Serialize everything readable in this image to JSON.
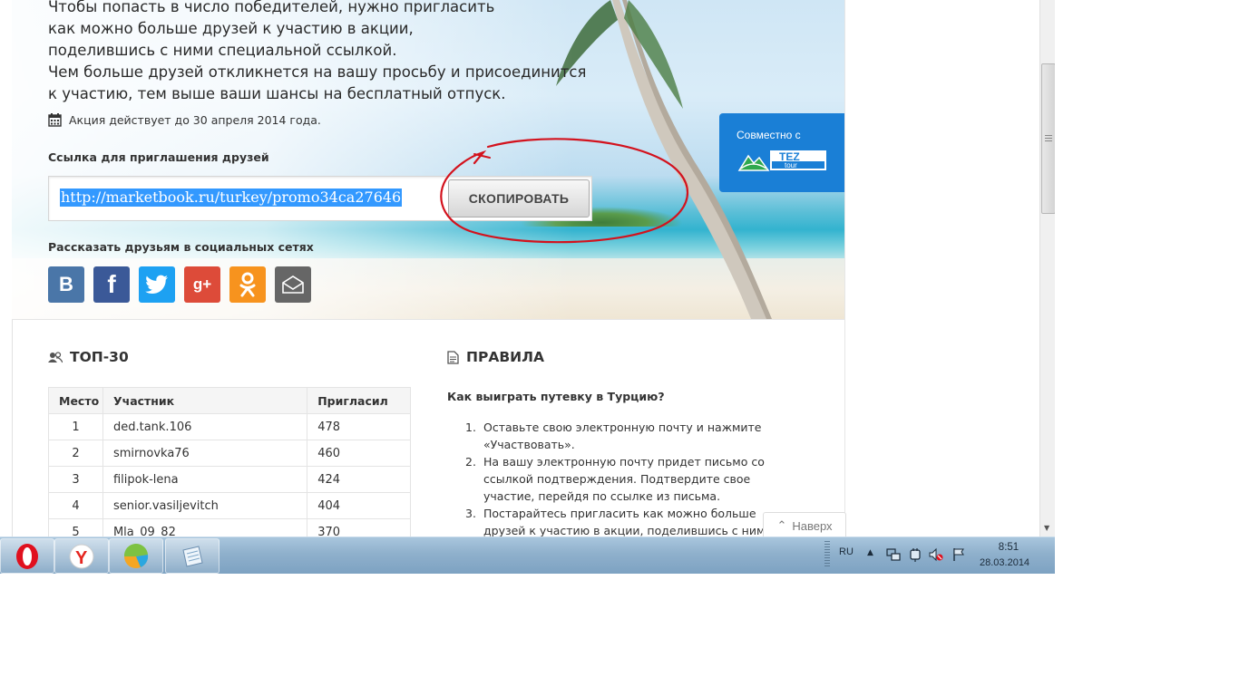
{
  "promo": {
    "lines": [
      "Чтобы попасть в число победителей, нужно пригласить",
      "как можно больше друзей к участию в акции,",
      "поделившись с ними специальной ссылкой.",
      "Чем больше друзей откликнется на вашу просьбу и присоединится",
      "к участию, тем выше ваши шансы на бесплатный отпуск."
    ],
    "date_text": "Акция действует до 30 апреля 2014 года.",
    "invite_label": "Ссылка для приглашения друзей",
    "invite_url": "http://marketbook.ru/turkey/promo34ca27646",
    "copy_button": "СКОПИРОВАТЬ",
    "share_label": "Рассказать друзьям в социальных сетях",
    "social": [
      {
        "name": "vk-icon",
        "glyph": "В",
        "color": "#4a76a8"
      },
      {
        "name": "facebook-icon",
        "glyph": "f",
        "color": "#3b5998"
      },
      {
        "name": "twitter-icon",
        "glyph": "",
        "color": "#1da1f2"
      },
      {
        "name": "google-plus-icon",
        "glyph": "g+",
        "color": "#dd4b39"
      },
      {
        "name": "odnoklassniki-icon",
        "glyph": "",
        "color": "#f7931e"
      },
      {
        "name": "mail-icon",
        "glyph": "",
        "color": "#666666"
      }
    ],
    "partner": {
      "label": "Совместно с",
      "logo_text_top": "TEZ",
      "logo_text_bottom": "tour"
    }
  },
  "top30": {
    "title": "ТОП-30",
    "columns": [
      "Место",
      "Участник",
      "Пригласил"
    ],
    "rows": [
      {
        "place": "1",
        "user": "ded.tank.106",
        "invited": "478"
      },
      {
        "place": "2",
        "user": "smirnovka76",
        "invited": "460"
      },
      {
        "place": "3",
        "user": "filipok-lena",
        "invited": "424"
      },
      {
        "place": "4",
        "user": "senior.vasiljevitch",
        "invited": "404"
      },
      {
        "place": "5",
        "user": "Mla_09_82",
        "invited": "370"
      }
    ]
  },
  "rules": {
    "title": "ПРАВИЛА",
    "question": "Как выиграть путевку в Турцию?",
    "items": [
      {
        "num": "1.",
        "text": "Оставьте свою электронную почту и нажмите «Участвовать»."
      },
      {
        "num": "2.",
        "text": "На вашу электронную почту придет письмо со ссылкой подтверждения. Подтвердите свое участие, перейдя по ссылке из письма."
      },
      {
        "num": "3.",
        "text": "Постарайтесь пригласить как можно больше друзей к участию в акции, поделившись с ними специальной"
      }
    ]
  },
  "back_to_top": "Наверх",
  "taskbar": {
    "apps": [
      {
        "name": "opera-taskbar-button"
      },
      {
        "name": "yandex-browser-taskbar-button"
      },
      {
        "name": "app-taskbar-button"
      },
      {
        "name": "notepad-taskbar-button"
      }
    ],
    "language": "RU",
    "time": "8:51",
    "date": "28.03.2014"
  },
  "colors": {
    "accent_blue": "#1a7fd6",
    "annotation_red": "#d3121d",
    "selection": "#3399ff"
  }
}
